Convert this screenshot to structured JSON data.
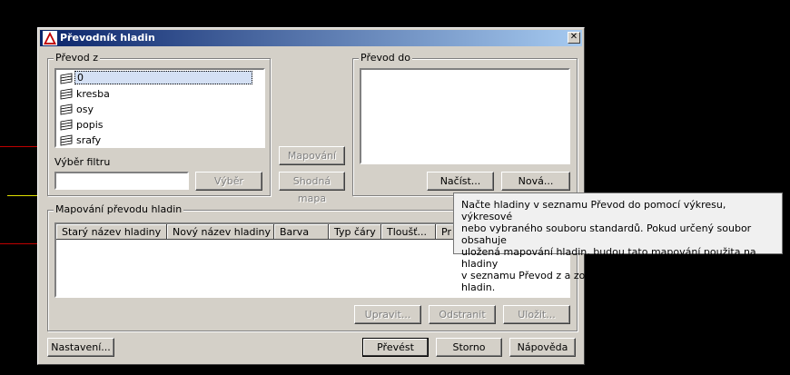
{
  "window": {
    "title": "Převodník hladin",
    "close_label": "✕"
  },
  "source": {
    "group_label": "Převod z",
    "layers": [
      {
        "name": "0"
      },
      {
        "name": "kresba"
      },
      {
        "name": "osy"
      },
      {
        "name": "popis"
      },
      {
        "name": "srafy"
      }
    ],
    "filter_label": "Výběr filtru",
    "filter_value": "",
    "select_button": "Výběr"
  },
  "middle": {
    "map_button": "Mapování",
    "same_map_button": "Shodná mapa"
  },
  "target": {
    "group_label": "Převod do",
    "load_button": "Načíst...",
    "new_button": "Nová..."
  },
  "mapping": {
    "group_label": "Mapování převodu hladin",
    "columns": [
      "Starý název hladiny",
      "Nový název hladiny",
      "Barva",
      "Typ čáry",
      "Tloušť...",
      "Pr"
    ],
    "edit_button": "Upravit...",
    "remove_button": "Odstranit",
    "save_button": "Uložit..."
  },
  "footer": {
    "settings_button": "Nastavení...",
    "convert_button": "Převést",
    "cancel_button": "Storno",
    "help_button": "Nápověda"
  },
  "tooltip": {
    "lines": [
      "Načte hladiny v seznamu Převod do pomocí výkresu, výkresové",
      "nebo vybraného souboru standardů. Pokud určený soubor obsahuje",
      "uložená mapování hladin, budou tato mapování použita na hladiny",
      "v seznamu Převod z a zobrazena v poli Mapování převodu hladin."
    ]
  },
  "colors": {
    "dialog_bg": "#d4d0c8",
    "title_start": "#0a246a",
    "title_end": "#a6caf0"
  }
}
